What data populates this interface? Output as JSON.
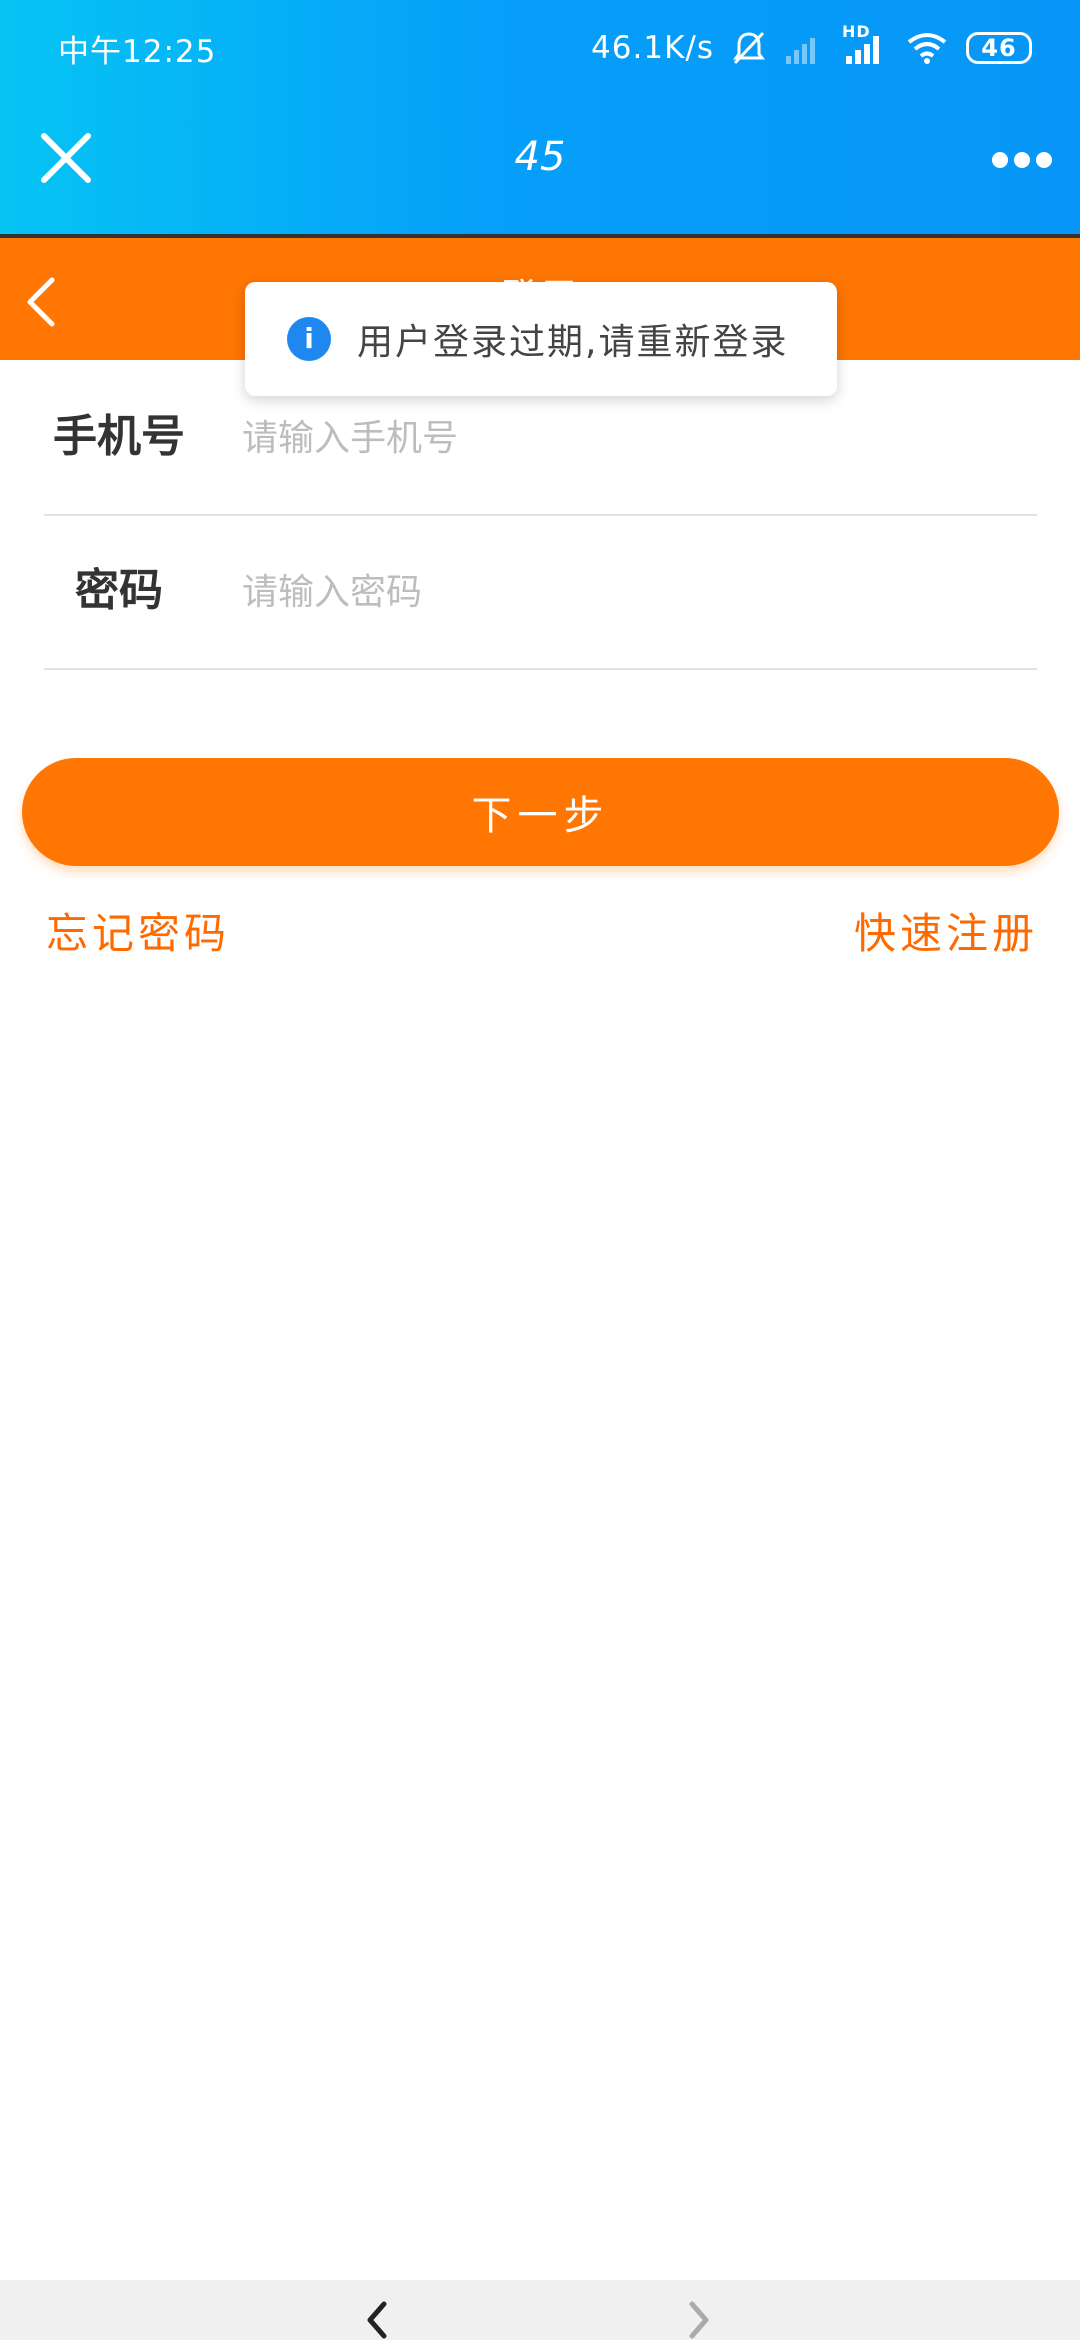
{
  "status_bar": {
    "time": "中午12:25",
    "network_speed": "46.1K/s",
    "signal_label": "HD",
    "battery": "46",
    "icons": [
      "mute-icon",
      "signal-empty-icon",
      "signal-hd-icon",
      "wifi-icon",
      "battery-icon"
    ]
  },
  "app_bar": {
    "title": "45",
    "close_icon": "close-icon",
    "more_icon": "more-icon"
  },
  "login_header": {
    "title": "登录",
    "back_icon": "chevron-left-icon"
  },
  "toast": {
    "icon": "info-icon",
    "icon_glyph": "i",
    "message": "用户登录过期,请重新登录"
  },
  "form": {
    "phone_label": "手机号",
    "phone_placeholder": "请输入手机号",
    "password_label": "密码",
    "password_placeholder": "请输入密码"
  },
  "actions": {
    "next_label": "下一步",
    "forgot_password": "忘记密码",
    "quick_register": "快速注册"
  },
  "colors": {
    "top_gradient_start": "#06c4f4",
    "top_gradient_end": "#0796f7",
    "accent_orange": "#ff7603",
    "link_orange": "#ff6a00",
    "toast_icon_blue": "#1e88f0"
  }
}
